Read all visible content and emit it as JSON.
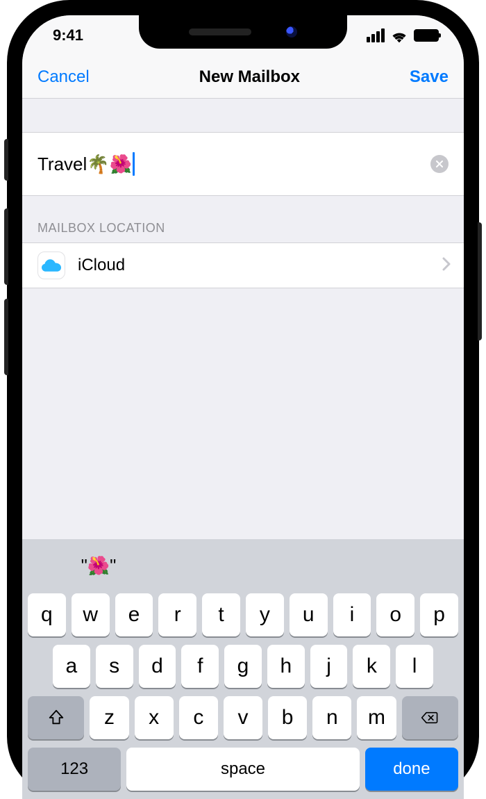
{
  "status": {
    "time": "9:41"
  },
  "nav": {
    "cancel": "Cancel",
    "title": "New Mailbox",
    "save": "Save"
  },
  "mailbox": {
    "name_value": "Travel🌴🌺"
  },
  "section": {
    "location_header": "MAILBOX LOCATION"
  },
  "location": {
    "account": "iCloud"
  },
  "keyboard": {
    "prediction": "\"🌺\"",
    "row1": [
      "q",
      "w",
      "e",
      "r",
      "t",
      "y",
      "u",
      "i",
      "o",
      "p"
    ],
    "row2": [
      "a",
      "s",
      "d",
      "f",
      "g",
      "h",
      "j",
      "k",
      "l"
    ],
    "row3": [
      "z",
      "x",
      "c",
      "v",
      "b",
      "n",
      "m"
    ],
    "numbers_key": "123",
    "space_key": "space",
    "return_key": "done"
  },
  "colors": {
    "accent": "#007aff"
  }
}
